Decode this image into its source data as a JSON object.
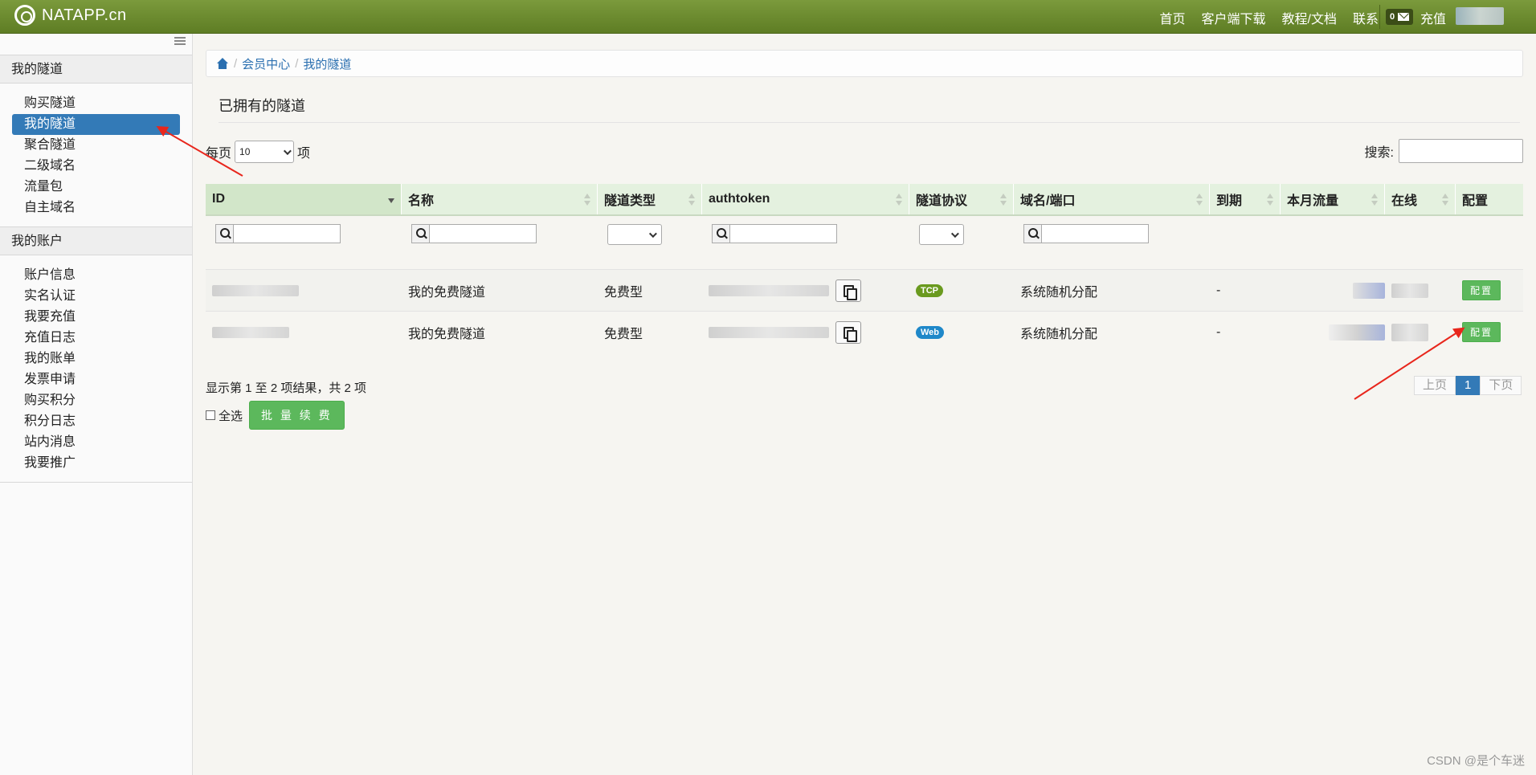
{
  "topbar": {
    "brand": "NATAPP.cn",
    "nav": [
      "首页",
      "客户端下载",
      "教程/文档",
      "联系"
    ],
    "message_count": "0",
    "recharge": "充值"
  },
  "sidebar": {
    "sections": [
      {
        "title": "我的隧道",
        "items": [
          "购买隧道",
          "我的隧道",
          "聚合隧道",
          "二级域名",
          "流量包",
          "自主域名"
        ],
        "active": "我的隧道"
      },
      {
        "title": "我的账户",
        "items": [
          "账户信息",
          "实名认证",
          "我要充值",
          "充值日志",
          "我的账单",
          "发票申请",
          "购买积分",
          "积分日志",
          "站内消息",
          "我要推广"
        ]
      }
    ]
  },
  "breadcrumb": [
    "会员中心",
    "我的隧道"
  ],
  "page_title": "已拥有的隧道",
  "controls": {
    "per_page_prefix": "每页",
    "per_page_value": "10",
    "per_page_suffix": "项",
    "search_label": "搜索:"
  },
  "table": {
    "columns": [
      "ID",
      "名称",
      "隧道类型",
      "authtoken",
      "隧道协议",
      "域名/端口",
      "到期",
      "本月流量",
      "在线",
      "配置"
    ],
    "rows": [
      {
        "name": "我的免费隧道",
        "type": "免费型",
        "protocol": "TCP",
        "domain": "系统随机分配",
        "expire": "-",
        "config": "配置"
      },
      {
        "name": "我的免费隧道",
        "type": "免费型",
        "protocol": "Web",
        "domain": "系统随机分配",
        "expire": "-",
        "config": "配置"
      }
    ]
  },
  "footer": {
    "info": "显示第 1 至 2 项结果，共 2 项",
    "select_all": "全选",
    "batch_button": "批 量 续 费"
  },
  "pagination": {
    "prev": "上页",
    "current": "1",
    "next": "下页"
  },
  "watermark": "CSDN @是个车迷",
  "colors": {
    "topbar": "#6b8a2e",
    "active": "#337ab7",
    "tcp_badge": "#6a9a1e",
    "web_badge": "#1f88c9",
    "button_green": "#5cb85c",
    "arrow": "#e8261c"
  }
}
